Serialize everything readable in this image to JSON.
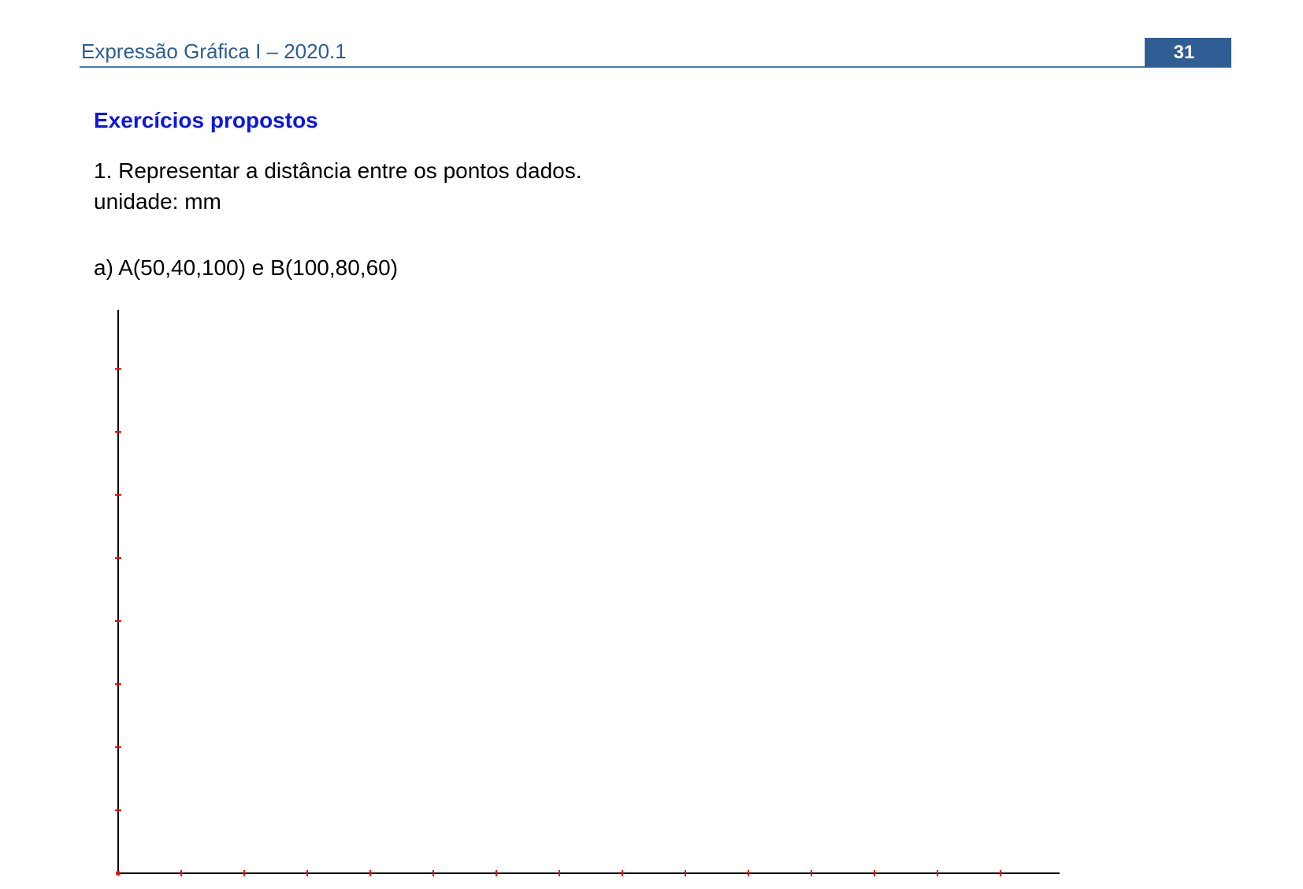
{
  "header": {
    "title": "Expressão Gráfica I – 2020.1",
    "page_number": "31"
  },
  "section": {
    "title": "Exercícios propostos"
  },
  "exercise": {
    "statement": "1. Representar a distância entre os pontos dados.",
    "unit": "unidade: mm",
    "item_a": "a) A(50,40,100) e B(100,80,60)"
  },
  "figure": {
    "axis_color": "#000000",
    "tick_color": "#ff0000",
    "vertical_tick_count": 8,
    "horizontal_tick_count": 14
  },
  "colors": {
    "header_text": "#2b5d93",
    "header_rule": "#4a7bb3",
    "page_badge": "#2f5d94",
    "section_title": "#0b16e6"
  }
}
